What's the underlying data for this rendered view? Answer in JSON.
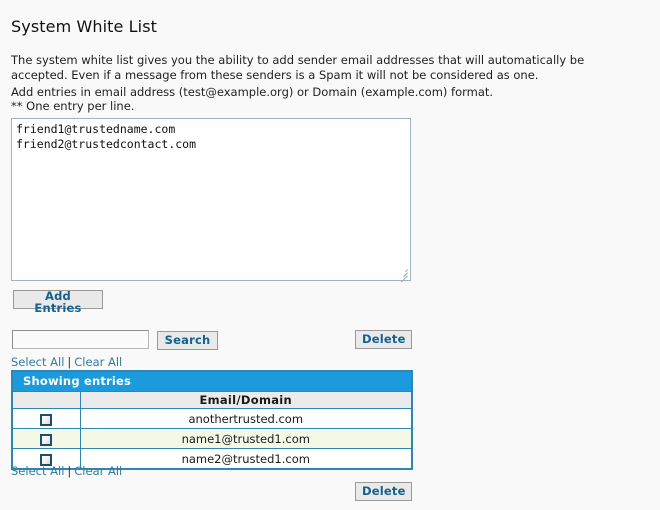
{
  "page": {
    "title": "System White List",
    "description": "The system white list gives you the ability to add sender email addresses that will automatically be accepted. Even if a message from these senders is a Spam it will not be considered as one.",
    "hint_line1": "Add entries in email address (test@example.org) or Domain (example.com) format.",
    "hint_line2": "** One entry per line."
  },
  "entries_form": {
    "textarea_value": "friend1@trustedname.com\nfriend2@trustedcontact.com",
    "textarea_placeholder": "",
    "add_button_label": "Add Entries"
  },
  "search": {
    "input_value": "",
    "input_placeholder": "",
    "search_button_label": "Search",
    "delete_button_label": "Delete"
  },
  "selection_links": {
    "select_all": "Select All",
    "separator": "|",
    "clear_all": "Clear All"
  },
  "table": {
    "caption": "Showing entries",
    "columns": [
      "",
      "Email/Domain"
    ],
    "rows": [
      {
        "checked": false,
        "email": "anothertrusted.com"
      },
      {
        "checked": false,
        "email": "name1@trusted1.com"
      },
      {
        "checked": false,
        "email": "name2@trusted1.com"
      }
    ]
  },
  "footer": {
    "delete_button_label": "Delete"
  },
  "colors": {
    "page_background": "#f9f9f9",
    "accent_blue": "#1b9bdb",
    "table_border": "#2f86b4",
    "link": "#2f7e9e",
    "button_text": "#14618e",
    "row_alt_background": "#f4f8e6",
    "header_row_background": "#ebebeb",
    "checkbox_border": "#1d4e6b"
  }
}
